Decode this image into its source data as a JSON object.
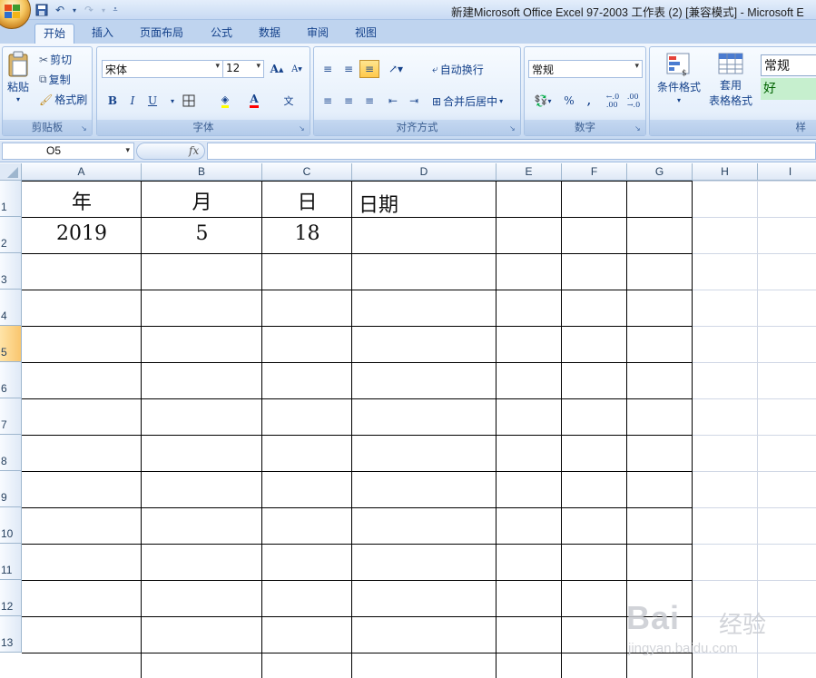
{
  "window": {
    "title": "新建Microsoft Office Excel 97-2003 工作表 (2)  [兼容模式] - Microsoft E"
  },
  "tabs": [
    "开始",
    "插入",
    "页面布局",
    "公式",
    "数据",
    "审阅",
    "视图"
  ],
  "ribbon": {
    "clipboard": {
      "label": "剪贴板",
      "paste": "粘贴",
      "cut": "剪切",
      "copy": "复制",
      "format_painter": "格式刷"
    },
    "font": {
      "label": "字体",
      "font_name": "宋体",
      "font_size": "12",
      "bold": "B",
      "italic": "I",
      "underline": "U"
    },
    "alignment": {
      "label": "对齐方式",
      "wrap_text": "自动换行",
      "merge_center": "合并后居中"
    },
    "number": {
      "label": "数字",
      "format": "常规",
      "percent": "%",
      "comma": ","
    },
    "styles": {
      "conditional_format": "条件格式",
      "table_format_line1": "套用",
      "table_format_line2": "表格格式",
      "style_normal": "常规",
      "style_good": "好",
      "label": "样"
    }
  },
  "formula_bar": {
    "name_box": "O5",
    "fx": "fx",
    "value": ""
  },
  "sheet": {
    "columns": [
      "A",
      "B",
      "C",
      "D",
      "E",
      "F",
      "G",
      "H",
      "I"
    ],
    "rows": [
      "1",
      "2",
      "3",
      "4",
      "5",
      "6",
      "7",
      "8",
      "9",
      "10",
      "11",
      "12",
      "13"
    ],
    "selected_row": "5",
    "cells": {
      "A1": "年",
      "B1": "月",
      "C1": "日",
      "D1": "日期",
      "A2": "2019",
      "B2": "5",
      "C2": "18"
    }
  },
  "watermark": {
    "brand": "Bai",
    "brand_cn": "经验",
    "url": "jingyan.baidu.com"
  },
  "colors": {
    "accent": "#15428b",
    "ribbon_bg": "#dde9f8",
    "selected_header": "#f9c66e",
    "style_good_bg": "#c6efce"
  }
}
